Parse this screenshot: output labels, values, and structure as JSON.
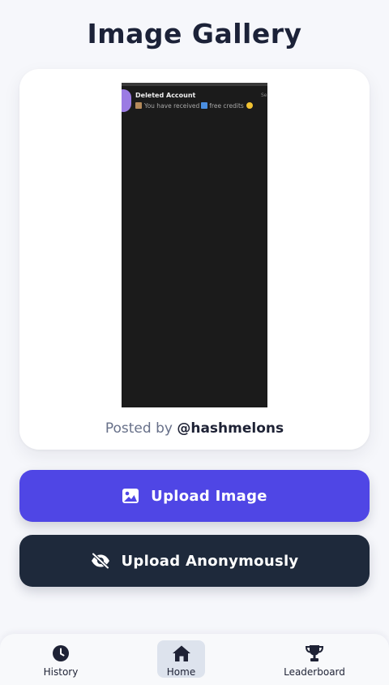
{
  "header": {
    "title": "Image Gallery"
  },
  "post": {
    "posted_by_prefix": "Posted by",
    "posted_by_handle": "@hashmelons",
    "screenshot": {
      "sender": "Deleted Account",
      "time": "Se",
      "preview_text_1": "You have received",
      "preview_text_2": "free credits"
    }
  },
  "actions": {
    "upload_label": "Upload Image",
    "upload_icon": "image-icon",
    "anonymous_label": "Upload Anonymously",
    "anonymous_icon": "eye-slash-icon"
  },
  "nav": {
    "items": [
      {
        "label": "History",
        "icon": "clock-icon"
      },
      {
        "label": "Home",
        "icon": "home-icon",
        "active": true
      },
      {
        "label": "Leaderboard",
        "icon": "trophy-icon"
      }
    ]
  },
  "colors": {
    "primary": "#4f46e5",
    "dark": "#1e293b",
    "background": "#f6f7fb",
    "active_nav": "#dde3ed"
  }
}
